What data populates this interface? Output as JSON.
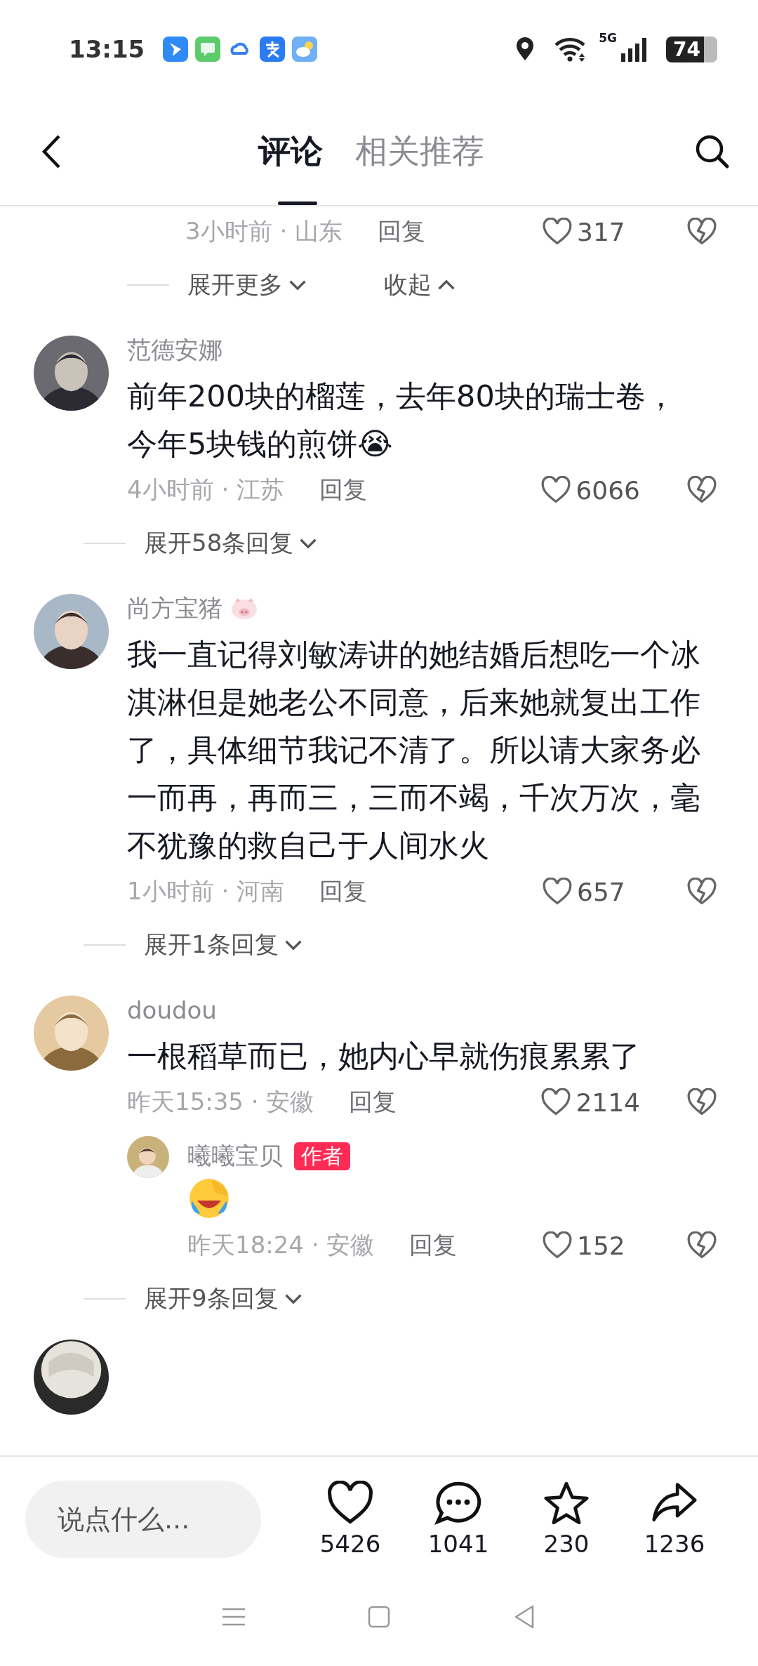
{
  "status_bar": {
    "time": "13:15",
    "network": "5G",
    "battery": "74"
  },
  "header": {
    "tabs": [
      {
        "label": "评论",
        "selected": true
      },
      {
        "label": "相关推荐",
        "selected": false
      }
    ]
  },
  "top_fragment": {
    "time_place": "3小时前 · 山东",
    "reply": "回复",
    "likes": "317",
    "expand": "展开更多",
    "collapse": "收起"
  },
  "comments": [
    {
      "name": "范德安娜",
      "name_sticker": false,
      "text": "前年200块的榴莲，去年80块的瑞士卷，今年5块钱的煎饼😭",
      "time_place": "4小时前 · 江苏",
      "reply": "回复",
      "likes": "6066",
      "expand": "展开58条回复"
    },
    {
      "name": "尚方宝猪",
      "name_sticker": true,
      "text": "我一直记得刘敏涛讲的她结婚后想吃一个冰淇淋但是她老公不同意，后来她就复出工作了，具体细节我记不清了。所以请大家务必一而再，再而三，三而不竭，千次万次，毫不犹豫的救自己于人间水火",
      "time_place": "1小时前 · 河南",
      "reply": "回复",
      "likes": "657",
      "expand": "展开1条回复"
    },
    {
      "name": "doudou",
      "name_sticker": false,
      "text": "一根稻草而已，她内心早就伤痕累累了",
      "time_place": "昨天15:35 · 安徽",
      "reply": "回复",
      "likes": "2114",
      "expand": "展开9条回复",
      "replies": [
        {
          "name": "曦曦宝贝",
          "badge": "作者",
          "emoji_only": true,
          "time_place": "昨天18:24 · 安徽",
          "reply": "回复",
          "likes": "152"
        }
      ]
    }
  ],
  "bottom_bar": {
    "placeholder": "说点什么...",
    "actions": [
      {
        "kind": "like",
        "count": "5426"
      },
      {
        "kind": "comment",
        "count": "1041"
      },
      {
        "kind": "favorite",
        "count": "230"
      },
      {
        "kind": "share",
        "count": "1236"
      }
    ]
  }
}
